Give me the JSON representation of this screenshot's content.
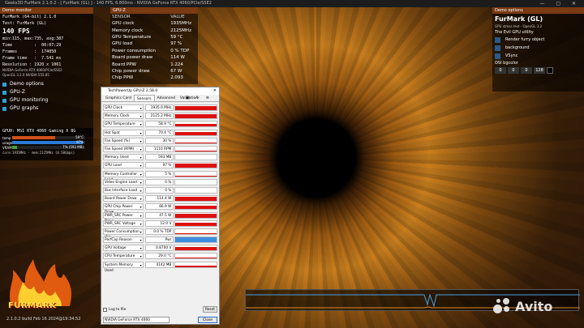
{
  "window": {
    "title": "Geeks3D FurMark 2.1.0.2 - [ FurMark (GL) ] - 140 FPS, 6.800ms - NVIDIA GeForce RTX 4060/PCIe/SSE2",
    "controls": "— ▢ ✕"
  },
  "left_panel": {
    "header": "Demo monitor",
    "app_line": "FurMark (64-bit) 2.1.0",
    "test_line": "Test: FurMark (GL)",
    "fps": "140 FPS",
    "fps_stats": "min:115, max:735, avg:387",
    "time": "Time         :  00:07:29",
    "frames": "Frames       :  174050",
    "frame_time": "Frame time   :  7.541 ms",
    "resolution": "Resolution : 1920 x 1061",
    "gpu_name": "NVIDIA GeForce RTX 4060/PCIe/SSE2",
    "opengl": "OpenGL 3.2.0 NVIDIA 555.85",
    "options": [
      {
        "label": "Demo options"
      },
      {
        "label": "GPU-Z"
      },
      {
        "label": "GPU monitoring"
      },
      {
        "label": "GPU graphs"
      }
    ],
    "gpu_header": "GPU0: MSI RTX 4060 Gaming X 8G",
    "meters": [
      {
        "label": "temp",
        "value": "59°C",
        "fraction": 0.59,
        "color": "#d0501a"
      },
      {
        "label": "usage",
        "value": "97%",
        "fraction": 0.97,
        "color": "#2a7ad8"
      },
      {
        "label": "VRAM",
        "value": "7% (593 MB)",
        "fraction": 0.07,
        "color": "#3fa33f"
      }
    ],
    "gpu_footer": "core:1935MHz - mem:2125MHz (8.50Gbps)"
  },
  "gpuz_overlay": {
    "header": "GPU-Z",
    "col_sensor": "SENSOR",
    "col_value": "VALUE",
    "rows": [
      {
        "sensor": "GPU clock",
        "value": "1935MHz"
      },
      {
        "sensor": "Memory clock",
        "value": "2125MHz"
      },
      {
        "sensor": "GPU Temperature",
        "value": "59 °C"
      },
      {
        "sensor": "GPU load",
        "value": "97 %"
      },
      {
        "sensor": "Power consumption",
        "value": "0 % TDP"
      },
      {
        "sensor": "Board power draw",
        "value": "114 W"
      },
      {
        "sensor": "Board PPW",
        "value": "1.224"
      },
      {
        "sensor": "Chip power draw",
        "value": "67 W"
      },
      {
        "sensor": "Chip PPW",
        "value": "2.093"
      }
    ]
  },
  "right_panel": {
    "header": "Demo options",
    "title": "FurMark (GL)",
    "subtitle": "GPU stress test - OpenGL 3.2",
    "utility": "The Evil GPU utility",
    "checks": [
      {
        "label": "Render furry object"
      },
      {
        "label": "background"
      },
      {
        "label": "VSync"
      }
    ],
    "bgcolor_label": "OSI bgcolor",
    "bgcolor_values": [
      "0",
      "0",
      "0",
      "128"
    ]
  },
  "gpuz": {
    "title": "TechPowerUp GPU-Z 2.58.0",
    "tabs": [
      "Graphics Card",
      "Sensors",
      "Advanced",
      "Validation"
    ],
    "active_tab": "Sensors",
    "rows": [
      {
        "name": "GPU Clock",
        "value": "1935.0 MHz",
        "fill": 0.9,
        "kind": "red"
      },
      {
        "name": "Memory Clock",
        "value": "2125.2 MHz",
        "fill": 0.9,
        "kind": "red"
      },
      {
        "name": "GPU Temperature",
        "value": "58.9 °C",
        "fill": 0.55,
        "kind": "red"
      },
      {
        "name": "Hot Spot",
        "value": "70.4 °C",
        "fill": 0.6,
        "kind": "red"
      },
      {
        "name": "Fan Speed (%)",
        "value": "30 %",
        "fill": 0.15,
        "kind": "red"
      },
      {
        "name": "Fan Speed (RPM)",
        "value": "1110 RPM",
        "fill": 0.15,
        "kind": "red"
      },
      {
        "name": "Memory Used",
        "value": "593 MB",
        "fill": 0.05,
        "kind": "red"
      },
      {
        "name": "GPU Load",
        "value": "97 %",
        "fill": 0.95,
        "kind": "red"
      },
      {
        "name": "Memory Controller Load",
        "value": "5 %",
        "fill": 0.05,
        "kind": "red"
      },
      {
        "name": "Video Engine Load",
        "value": "0 %",
        "fill": 0.0,
        "kind": "red"
      },
      {
        "name": "Bus Interface Load",
        "value": "0 %",
        "fill": 0.0,
        "kind": "red"
      },
      {
        "name": "Board Power Draw",
        "value": "114.4 W",
        "fill": 0.85,
        "kind": "red"
      },
      {
        "name": "GPU Chip Power Draw",
        "value": "66.9 W",
        "fill": 0.75,
        "kind": "red"
      },
      {
        "name": "PWR_SRC Power Draw",
        "value": "47.5 W",
        "fill": 0.7,
        "kind": "red"
      },
      {
        "name": "PWR_SRC Voltage",
        "value": "12.0 V",
        "fill": 0.6,
        "kind": "red"
      },
      {
        "name": "Power Consumption (%)",
        "value": "0.0 % TDP",
        "fill": 0.05,
        "kind": "red"
      },
      {
        "name": "PerfCap Reason",
        "value": "Pwr",
        "fill": 1.0,
        "kind": "blue"
      },
      {
        "name": "GPU Voltage",
        "value": "0.8700 V",
        "fill": 0.65,
        "kind": "red"
      },
      {
        "name": "CPU Temperature",
        "value": "29.0 °C",
        "fill": 0.25,
        "kind": "red"
      },
      {
        "name": "System Memory Used",
        "value": "4142 MB",
        "fill": 0.3,
        "kind": "red"
      }
    ],
    "log_label": "Log to file",
    "reset_label": "Reset",
    "device": "NVIDIA GeForce RTX 4060",
    "close_label": "Close"
  },
  "branding": {
    "logo": "FURMARK",
    "build": "2.1.0.2 build Feb 16 2024@19:34:52",
    "watermark": "Avito"
  }
}
